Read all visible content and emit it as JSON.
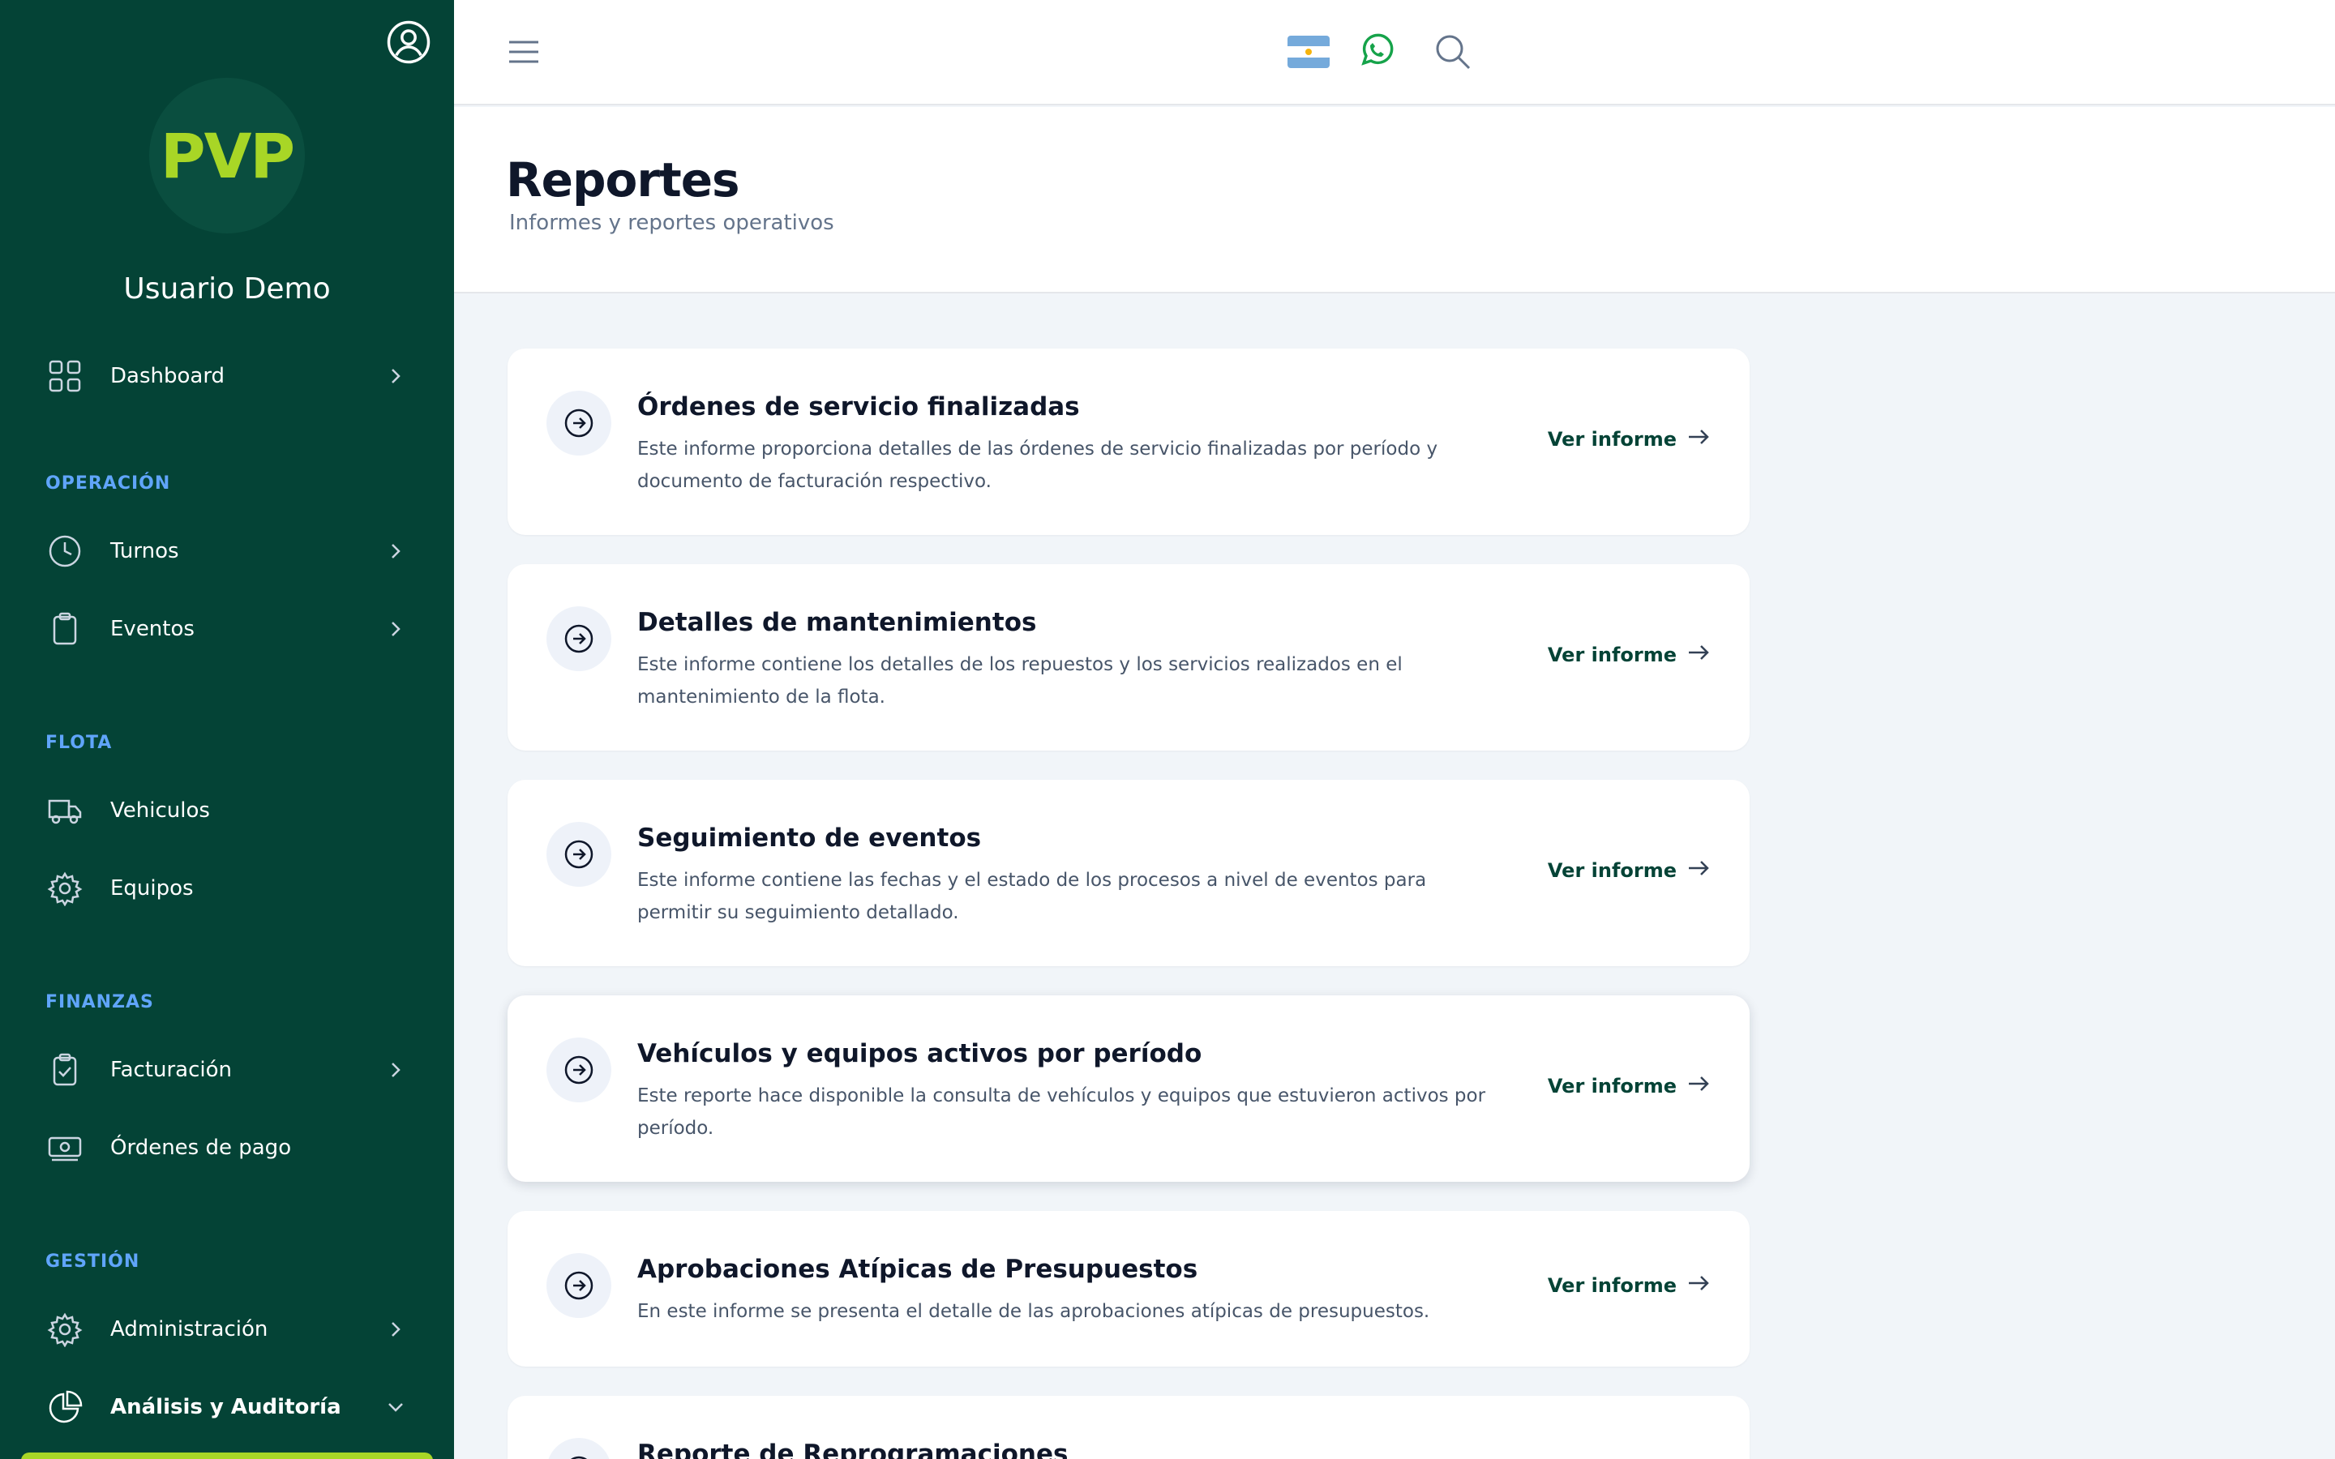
{
  "sidebar": {
    "logo_text": "PVP",
    "user_name": "Usuario Demo",
    "items": [
      {
        "label": "Dashboard"
      },
      {
        "label": "Turnos"
      },
      {
        "label": "Eventos"
      },
      {
        "label": "Vehiculos"
      },
      {
        "label": "Equipos"
      },
      {
        "label": "Facturación"
      },
      {
        "label": "Órdenes de pago"
      },
      {
        "label": "Administración"
      },
      {
        "label": "Análisis y Auditoría"
      }
    ],
    "sections": {
      "operacion": "OPERACIÓN",
      "flota": "FLOTA",
      "finanzas": "FINANZAS",
      "gestion": "GESTIÓN"
    }
  },
  "header": {
    "icons": [
      "menu-icon",
      "argentina-flag-icon",
      "whatsapp-icon",
      "search-icon"
    ]
  },
  "page": {
    "title": "Reportes",
    "subtitle": "Informes y reportes operativos"
  },
  "reports": [
    {
      "title": "Órdenes de servicio finalizadas",
      "description": "Este informe proporciona detalles de las órdenes de servicio finalizadas por período y documento de facturación respectivo.",
      "link": "Ver informe"
    },
    {
      "title": "Detalles de mantenimientos",
      "description": "Este informe contiene los detalles de los repuestos y los servicios realizados en el mantenimiento de la flota.",
      "link": "Ver informe"
    },
    {
      "title": "Seguimiento de eventos",
      "description": "Este informe contiene las fechas y el estado de los procesos a nivel de eventos para permitir su seguimiento detallado.",
      "link": "Ver informe"
    },
    {
      "title": "Vehículos y equipos activos por período",
      "description": "Este reporte hace disponible la consulta de vehículos y equipos que estuvieron activos por período.",
      "link": "Ver informe"
    },
    {
      "title": "Aprobaciones Atípicas de Presupuestos",
      "description": "En este informe se presenta el detalle de las aprobaciones atípicas de presupuestos.",
      "link": "Ver informe"
    },
    {
      "title": "Reporte de Reprogramaciones",
      "description": "",
      "link": ""
    }
  ],
  "colors": {
    "sidebar_bg": "#044336",
    "brand_lime": "#a8d626",
    "section_label": "#60a5fa",
    "page_bg": "#f1f5f9"
  }
}
